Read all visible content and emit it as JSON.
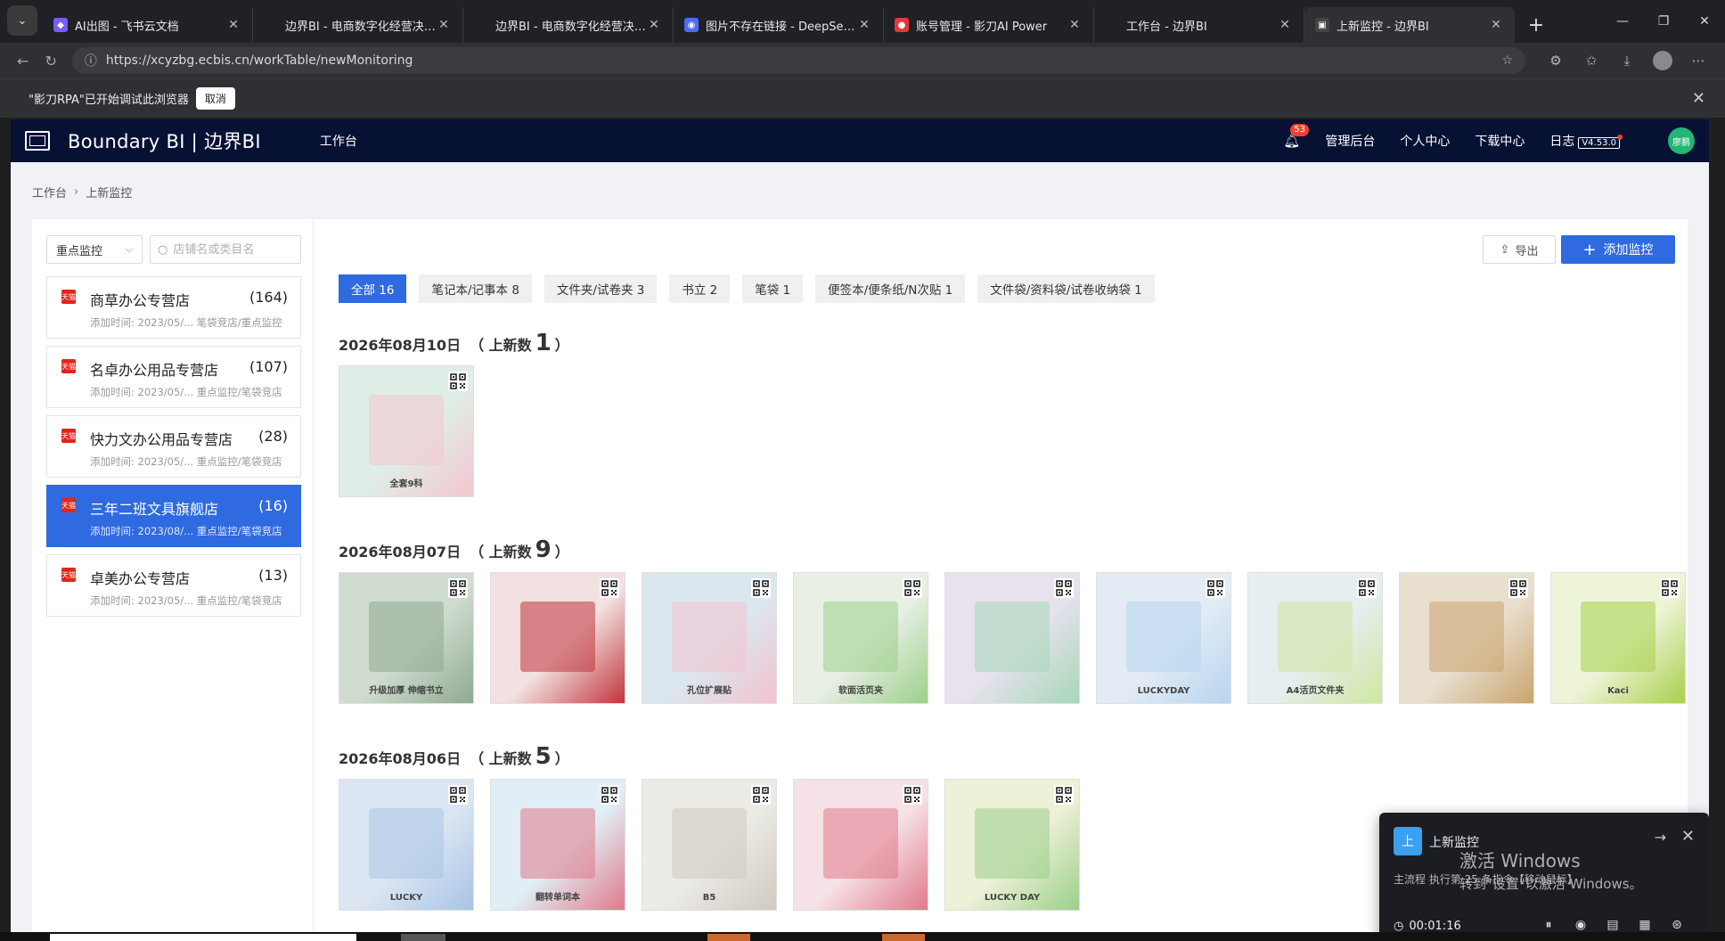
{
  "browser": {
    "tabs": [
      {
        "title": "AI出图 - 飞书云文档",
        "favicon_color": "#7b5cff",
        "favicon_glyph": "◆",
        "active": false
      },
      {
        "title": "边界BI - 电商数字化经营决策系统",
        "favicon_color": "",
        "favicon_glyph": "",
        "active": false
      },
      {
        "title": "边界BI - 电商数字化经营决策系统",
        "favicon_color": "",
        "favicon_glyph": "",
        "active": false
      },
      {
        "title": "图片不存在链接 - DeepSeek",
        "favicon_color": "#4d6bfe",
        "favicon_glyph": "◉",
        "active": false
      },
      {
        "title": "账号管理 - 影刀AI Power",
        "favicon_color": "#e53935",
        "favicon_glyph": "●",
        "active": false
      },
      {
        "title": "工作台 - 边界BI",
        "favicon_color": "",
        "favicon_glyph": "",
        "active": false
      },
      {
        "title": "上新监控 - 边界BI",
        "favicon_color": "#444",
        "favicon_glyph": "▣",
        "active": true
      }
    ],
    "url": "https://xcyzbg.ecbis.cn/workTable/newMonitoring",
    "infobar_text": "\"影刀RPA\"已开始调试此浏览器",
    "infobar_cancel": "取消"
  },
  "app": {
    "brand": "Boundary BI | 边界BI",
    "nav_workbench": "工作台",
    "notification_count": "53",
    "header_links": [
      "管理后台",
      "个人中心",
      "下载中心"
    ],
    "log_label": "日志",
    "version": "V4.53.0",
    "avatar_text": "廖鹏"
  },
  "breadcrumb": {
    "home": "工作台",
    "current": "上新监控"
  },
  "filters": {
    "select_value": "重点监控",
    "search_placeholder": "店铺名或类目名"
  },
  "stores": [
    {
      "name": "商草办公专营店",
      "count": "(164)",
      "meta": "添加时间: 2023/05/... 笔袋竞店/重点监控",
      "selected": false
    },
    {
      "name": "名卓办公用品专营店",
      "count": "(107)",
      "meta": "添加时间: 2023/05/... 重点监控/笔袋竞店",
      "selected": false
    },
    {
      "name": "快力文办公用品专营店",
      "count": "(28)",
      "meta": "添加时间: 2023/05/... 重点监控/笔袋竞店",
      "selected": false
    },
    {
      "name": "三年二班文具旗舰店",
      "count": "(16)",
      "meta": "添加时间: 2023/08/... 重点监控/笔袋竞店",
      "selected": true
    },
    {
      "name": "卓美办公专营店",
      "count": "(13)",
      "meta": "添加时间: 2023/05/... 重点监控/笔袋竞店",
      "selected": false
    }
  ],
  "store_badge": "天猫",
  "actions": {
    "export": "导出",
    "add": "添加监控"
  },
  "categories": [
    {
      "label": "全部 16",
      "active": true
    },
    {
      "label": "笔记本/记事本 8",
      "active": false
    },
    {
      "label": "文件夹/试卷夹 3",
      "active": false
    },
    {
      "label": "书立 2",
      "active": false
    },
    {
      "label": "笔袋 1",
      "active": false
    },
    {
      "label": "便签本/便条纸/N次贴 1",
      "active": false
    },
    {
      "label": "文件袋/资料袋/试卷收纳袋 1",
      "active": false
    }
  ],
  "new_count_label": "上新数",
  "days": [
    {
      "date": "2026年08月10日",
      "count": "1",
      "thumbs": [
        {
          "bg": "#dfeee6",
          "accent": "#f4c6d0",
          "label": "全套9科"
        }
      ]
    },
    {
      "date": "2026年08月07日",
      "count": "9",
      "thumbs": [
        {
          "bg": "#cfdccf",
          "accent": "#8fa98f",
          "label": "升级加厚 伸缩书立"
        },
        {
          "bg": "#f3e1e1",
          "accent": "#c0353c",
          "label": ""
        },
        {
          "bg": "#dbe7ef",
          "accent": "#f2c3cf",
          "label": "孔位扩展贴"
        },
        {
          "bg": "#e8efe4",
          "accent": "#9bd08a",
          "label": "软面活页夹"
        },
        {
          "bg": "#e7e2ee",
          "accent": "#a6d7b8",
          "label": ""
        },
        {
          "bg": "#e3ecf5",
          "accent": "#b7d5ef",
          "label": "LUCKYDAY"
        },
        {
          "bg": "#e6eef0",
          "accent": "#cfe6a0",
          "label": "A4活页文件夹"
        },
        {
          "bg": "#e9dfcf",
          "accent": "#caa46e",
          "label": ""
        },
        {
          "bg": "#eef4d8",
          "accent": "#a8d04b",
          "label": "Kaci"
        }
      ]
    },
    {
      "date": "2026年08月06日",
      "count": "5",
      "thumbs": [
        {
          "bg": "#dce6f2",
          "accent": "#a9c4e6",
          "label": "LUCKY"
        },
        {
          "bg": "#e1eef5",
          "accent": "#e07a8b",
          "label": "翻转单词本"
        },
        {
          "bg": "#ecebe6",
          "accent": "#cfcabf",
          "label": "B5"
        },
        {
          "bg": "#f6e2e6",
          "accent": "#e07a8b",
          "label": ""
        },
        {
          "bg": "#eef0d8",
          "accent": "#9bd08a",
          "label": "LUCKY DAY"
        }
      ]
    }
  ],
  "task_widget": {
    "icon_text": "上",
    "title": "上新监控",
    "status": "主流程 执行第 25 条指令【移动鼠标】",
    "timer": "00:01:16"
  },
  "windows_watermark": {
    "line1": "激活 Windows",
    "line2": "转到\"设置\"以激活 Windows。"
  }
}
